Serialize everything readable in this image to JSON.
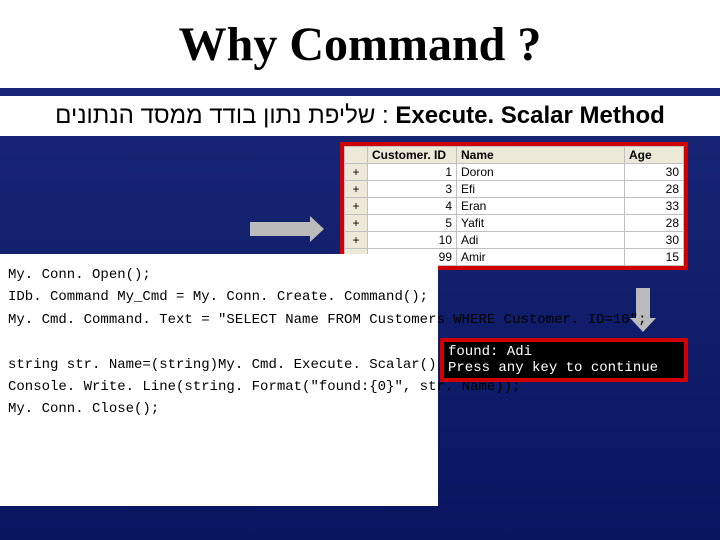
{
  "title": "Why Command ?",
  "subtitle_hebrew": "שליפת נתון בודד ממסד הנתונים",
  "subtitle_method": "Execute. Scalar Method",
  "table": {
    "headers": [
      "",
      "Customer. ID",
      "Name",
      "Age"
    ],
    "rows": [
      {
        "id": "1",
        "name": "Doron",
        "age": "30"
      },
      {
        "id": "3",
        "name": "Efi",
        "age": "28"
      },
      {
        "id": "4",
        "name": "Eran",
        "age": "33"
      },
      {
        "id": "5",
        "name": "Yafit",
        "age": "28"
      },
      {
        "id": "10",
        "name": "Adi",
        "age": "30"
      },
      {
        "id": "99",
        "name": "Amir",
        "age": "15"
      }
    ]
  },
  "code": {
    "line1": "My. Conn. Open();",
    "line2": "IDb. Command My_Cmd = My. Conn. Create. Command();",
    "line3": "My. Cmd. Command. Text = \"SELECT Name FROM Customers WHERE Customer. ID=10\";",
    "line4": "string str. Name=(string)My. Cmd. Execute. Scalar();",
    "line5": "Console. Write. Line(string. Format(\"found:{0}\", str. Name));",
    "line6": "My. Conn. Close();"
  },
  "output": {
    "line1": "found: Adi",
    "line2": "Press any key to continue"
  }
}
